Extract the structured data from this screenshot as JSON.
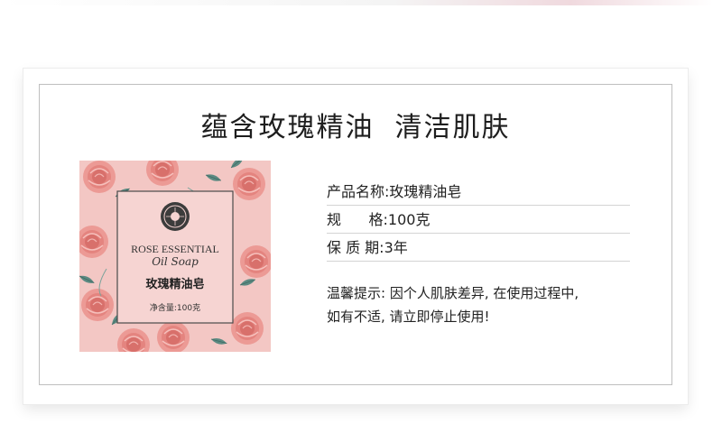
{
  "headline": "蕴含玫瑰精油  清洁肌肤",
  "product_box": {
    "brand_line1": "ROSE ESSENTIAL",
    "brand_line2": "Oil Soap",
    "name_cn": "玫瑰精油皂",
    "net_content": "净含量:100克"
  },
  "specs": [
    {
      "label": "产品名称:",
      "value": "玫瑰精油皂"
    },
    {
      "label": "规      格:",
      "value": "100克"
    },
    {
      "label": "保 质 期:",
      "value": "3年"
    }
  ],
  "tip": {
    "line1": "温馨提示: 因个人肌肤差异, 在使用过程中,",
    "line2": "如有不适, 请立即停止使用!"
  },
  "colors": {
    "box_pink": "#f3c7c4",
    "rose": "#e88f8a",
    "leaf": "#5c8a82",
    "text_dark": "#1e1e1e"
  }
}
